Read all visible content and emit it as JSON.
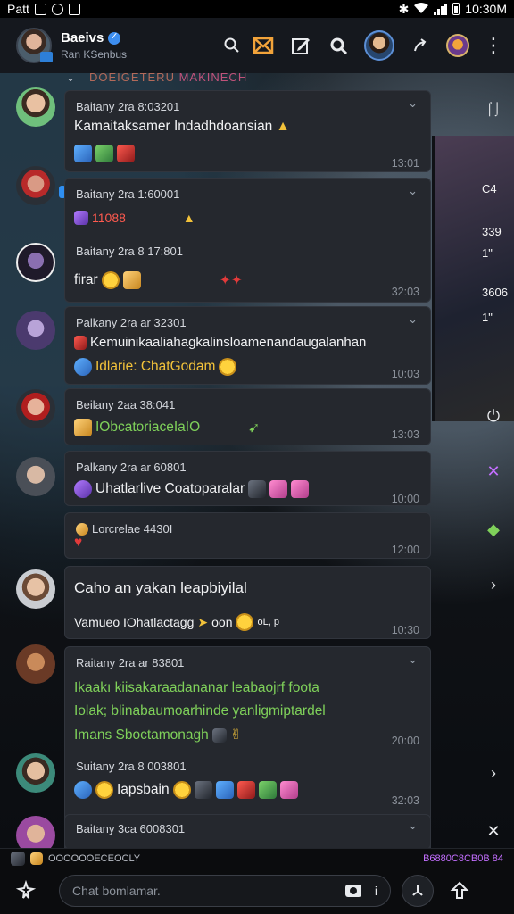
{
  "status_bar": {
    "carrier": "Patt",
    "time": "10:30M"
  },
  "header": {
    "name": "Baeivs",
    "subtitle": "Ran KSenbus"
  },
  "banner": {
    "left": "DOEIGETERU",
    "right": "MAKINECH"
  },
  "side": {
    "top_label": "1"
  },
  "monitor_readouts": [
    "C4",
    "339",
    "1\"",
    "3606",
    "1\""
  ],
  "messages": [
    {
      "meta": "Baitany 2ra 8:03201",
      "text": "Kamaitaksamer Indadhdoansian",
      "time": "13:01",
      "has_chevron": true
    },
    {
      "meta": "Baitany 2ra 1:60001",
      "text": "11088",
      "time": "",
      "has_chevron": true
    },
    {
      "meta": "Baitany 2ra 8 17:801",
      "text": "firar",
      "time": "32:03",
      "has_chevron": false
    },
    {
      "meta": "Palkany 2ra ar 32301",
      "text": "Kemuinikaaliahagkalinsloamenandaugalanhan",
      "text2": "Idlarie: ChatGodam",
      "time": "10:03",
      "has_chevron": true
    },
    {
      "meta": "Beilany 2aa 38:041",
      "text": "IObcatoriaceIaIO",
      "time": "13:03",
      "has_chevron": false
    },
    {
      "meta": "Palkany 2ra ar 60801",
      "text": "Uhatlarlive Coatoparalar",
      "time": "10:00",
      "has_chevron": false
    },
    {
      "meta": "Lorcrelae 4430I",
      "text": "",
      "time": "12:00",
      "has_chevron": false
    },
    {
      "meta": "",
      "text": "Caho an yakan leapbiyilal",
      "text2": "Vamueo IOhatlactagg",
      "text2b": "oon",
      "text2c": "oL, p",
      "time": "10:30",
      "has_chevron": false
    },
    {
      "meta": "Raitany 2ra ar 83801",
      "lines": [
        "Ikaakı kiisakaraadananar leabaojrf foota",
        "Iolak; blinabaumoarhinde yanligmiptardel",
        "Imans Sboctamonagh"
      ],
      "time": "20:00",
      "has_chevron": true
    },
    {
      "meta": "Suitany 2ra 8 003801",
      "text": "Iapsbain",
      "time": "32:03",
      "has_chevron": false
    },
    {
      "meta": "Baitany 3ca 6008301",
      "text": "",
      "time": "",
      "has_chevron": true
    }
  ],
  "strip": {
    "left": "OOOOOOECEOCLY",
    "right": "B6880C8CB0B 84"
  },
  "composer": {
    "placeholder": "Chat bomlamar.",
    "info": "i"
  },
  "colors": {
    "accent_orange": "#f2a33a",
    "accent_blue": "#3d8ef0",
    "card_bg": "#25282e",
    "green_text": "#7fd15a"
  }
}
